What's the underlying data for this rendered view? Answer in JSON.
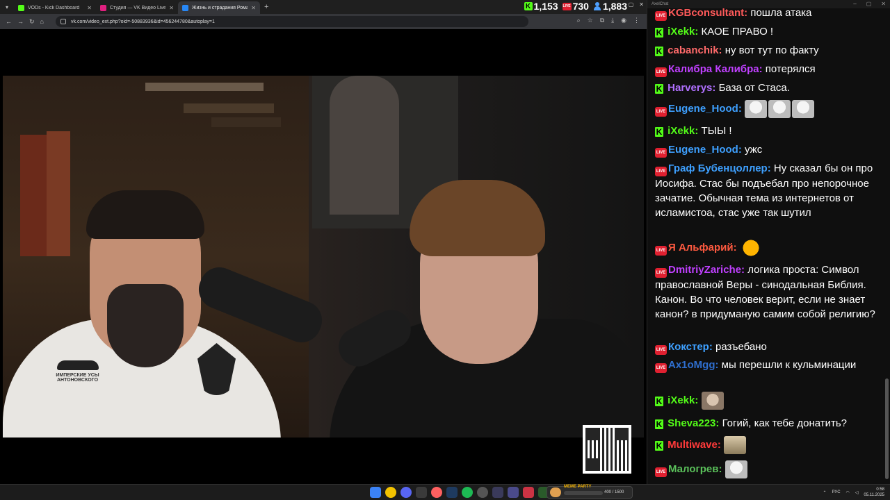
{
  "browser": {
    "tabs": [
      {
        "title": "VODs - Kick Dashboard",
        "favicon_color": "#53fc18",
        "active": false
      },
      {
        "title": "Студия — VK Видео Live",
        "favicon_color": "#e02080",
        "active": false
      },
      {
        "title": "Жизнь и страдания Роман...",
        "favicon_color": "#2787f5",
        "active": true
      }
    ],
    "url": "vk.com/video_ext.php?oid=-50883936&id=456244780&autoplay=1"
  },
  "stats": {
    "kick_viewers": "1,153",
    "live_viewers": "730",
    "total_viewers": "1,883",
    "kick_icon": "K",
    "live_icon": "LIVE"
  },
  "video": {
    "shirt_text_1": "ИМПЕРСКИЕ УСЫ",
    "shirt_text_2": "АНТОНОВСКОГО"
  },
  "chat": {
    "window_title": "AxelChat",
    "messages": [
      {
        "source": "live",
        "user": "KGBconsultant:",
        "color": "#ff5a5a",
        "text": "пошла атака"
      },
      {
        "source": "kick",
        "user": "iXekk:",
        "color": "#53fc18",
        "text": "КАОЕ ПРАВО !"
      },
      {
        "source": "kick",
        "user": "cabanchik:",
        "color": "#ff6a6a",
        "text": "ну вот тут по факту"
      },
      {
        "source": "live",
        "user": "Калибра Калибра:",
        "color": "#c040ff",
        "text": "потерялся"
      },
      {
        "source": "kick",
        "user": "Harverys:",
        "color": "#b070ff",
        "text": "База от Стаса."
      },
      {
        "source": "live",
        "user": "Eugene_Hood:",
        "color": "#3ea0ff",
        "text": ""
      },
      {
        "source": "kick",
        "user": "iXekk:",
        "color": "#53fc18",
        "text": "ТЫЫ !"
      },
      {
        "source": "live",
        "user": "Eugene_Hood:",
        "color": "#3ea0ff",
        "text": "ужс"
      },
      {
        "source": "live",
        "user": "Граф Бубенцоллер:",
        "color": "#3ea0ff",
        "text": "Ну сказал бы он про Иосифа. Стас бы подъебал про непорочное зачатие. Обычная тема из интернетов от исламистоа, стас уже так шутил"
      },
      {
        "source": "live",
        "user": "Я Альфарий:",
        "color": "#ff5a40",
        "text": ""
      },
      {
        "source": "live",
        "user": "DmitriyZariche:",
        "color": "#c040ff",
        "text": "логика проста: Символ православной Веры - синодальная Библия. Канон. Во что человек верит, если не знает канон? в придуманую самим собой религию?"
      },
      {
        "source": "live",
        "user": "Кокстер:",
        "color": "#3ea0ff",
        "text": "разъебано"
      },
      {
        "source": "live",
        "user": "Ax1oMgg:",
        "color": "#2f6fd0",
        "text": "мы перешли к кульминации"
      },
      {
        "source": "kick",
        "user": "iXekk:",
        "color": "#53fc18",
        "text": ""
      },
      {
        "source": "kick",
        "user": "Sheva223:",
        "color": "#53fc18",
        "text": "Гогий, как тебе донатить?"
      },
      {
        "source": "kick",
        "user": "Multiwave:",
        "color": "#ff3a3a",
        "text": ""
      },
      {
        "source": "live",
        "user": "Малогрев:",
        "color": "#5ac05a",
        "text": ""
      }
    ]
  },
  "taskbar": {
    "meme_title": "MEME PARTY",
    "meme_count": "400 / 1500",
    "lang": "РУС",
    "time": "0:58",
    "date": "05.11.2025"
  }
}
